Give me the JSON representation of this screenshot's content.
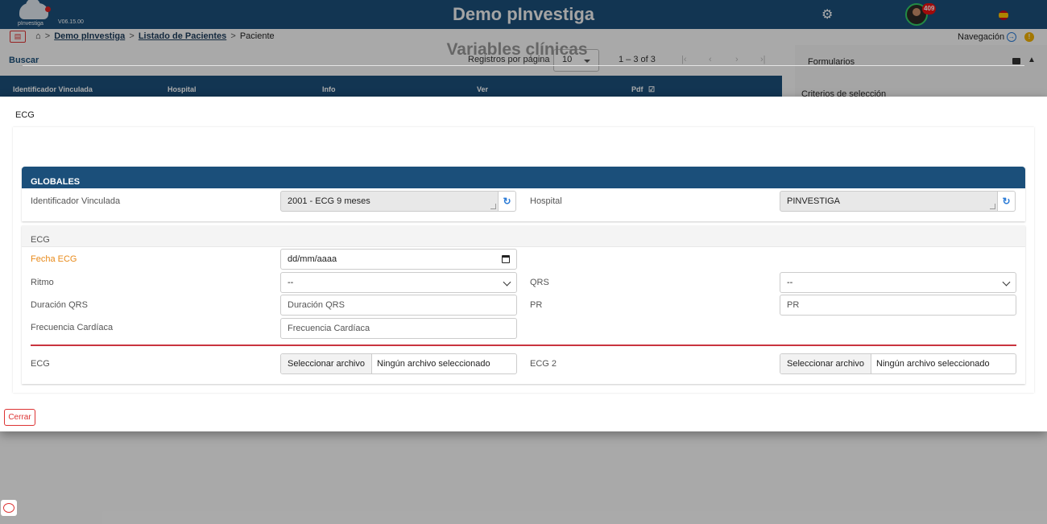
{
  "app": {
    "title": "Demo pInvestiga",
    "brand": "pInvestiga",
    "version": "V06.15.00",
    "notifications": "409"
  },
  "breadcrumb": {
    "items": [
      "Demo pInvestiga",
      "Listado de Pacientes",
      "Paciente"
    ],
    "separator": ">"
  },
  "navigation": {
    "label": "Navegación"
  },
  "list": {
    "search_label": "Buscar",
    "rows_per_page_label": "Registros por página",
    "rows_per_page": "10",
    "range": "1 – 3 of 3",
    "columns": [
      "Identificador Vinculada",
      "Hospital",
      "Info",
      "Ver",
      "Pdf"
    ]
  },
  "side_panel": {
    "title": "Formularios",
    "subtitle": "Criterios de selección"
  },
  "dialog": {
    "title": "ECG",
    "form_title": "Variables clínicas",
    "globales": {
      "header": "GLOBALES",
      "identificador_label": "Identificador Vinculada",
      "identificador_value": "2001 - ECG 9 meses",
      "hospital_label": "Hospital",
      "hospital_value": "PINVESTIGA"
    },
    "ecg": {
      "header": "ECG",
      "fecha_label": "Fecha ECG",
      "fecha_placeholder": "dd/mm/aaaa",
      "ritmo_label": "Ritmo",
      "ritmo_value": "--",
      "qrs_label": "QRS",
      "qrs_value": "--",
      "duracion_label": "Duración QRS",
      "duracion_placeholder": "Duración QRS",
      "pr_label": "PR",
      "pr_placeholder": "PR",
      "frecuencia_label": "Frecuencia Cardíaca",
      "frecuencia_placeholder": "Frecuencia Cardíaca",
      "file1_label": "ECG",
      "file2_label": "ECG 2",
      "file_button": "Seleccionar archivo",
      "file_none": "Ningún archivo seleccionado"
    },
    "close_label": "Cerrar"
  },
  "colors": {
    "primary": "#1b4f7a",
    "required_label": "#e88a1a",
    "danger": "#c9343e",
    "refresh_icon": "#2b7bd6"
  }
}
